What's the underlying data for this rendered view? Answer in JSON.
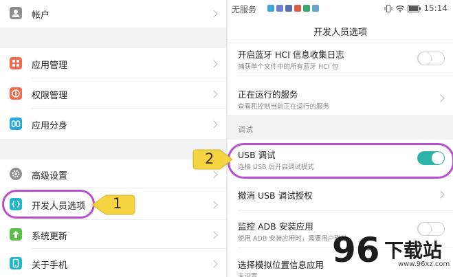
{
  "left": {
    "items": [
      {
        "label": "帐户",
        "icon": "account-icon",
        "color": "#8e8e8e"
      },
      {
        "label": "应用管理",
        "icon": "apps-icon",
        "color": "#f26b4f"
      },
      {
        "label": "权限管理",
        "icon": "permission-icon",
        "color": "#f26b4f"
      },
      {
        "label": "应用分身",
        "icon": "app-twin-icon",
        "color": "#23a9e0"
      },
      {
        "label": "高级设置",
        "icon": "gear-icon",
        "color": "#8e8e8e"
      },
      {
        "label": "开发人员选项",
        "icon": "developer-braces-icon",
        "color": "#23b5c8"
      },
      {
        "label": "系统更新",
        "icon": "update-arrow-icon",
        "color": "#5cbf4a"
      },
      {
        "label": "关于手机",
        "icon": "phone-icon",
        "color": "#23b5c8"
      }
    ]
  },
  "status": {
    "carrier": "无服务",
    "time": "15:14"
  },
  "right": {
    "title": "开发人员选项",
    "items": [
      {
        "title": "开启蓝牙 HCI 信息收集日志",
        "subtitle": "捕获单个文件中的所有蓝牙 HCI 包",
        "control": "toggle",
        "on": false
      },
      {
        "title": "正在运行的服务",
        "subtitle": "查看和控制当前正在运行的服务",
        "control": "chevron"
      },
      {
        "title": "USB 调试",
        "subtitle": "连接 USB 后开启调试模式",
        "control": "toggle",
        "on": true
      },
      {
        "title": "撤消 USB 调试授权",
        "subtitle": "",
        "control": "chevron"
      },
      {
        "title": "监控 ADB 安装应用",
        "subtitle": "使用 ADB 安装应用时，需要用户确认",
        "control": "toggle",
        "on": false
      },
      {
        "title": "选择模拟位置信息应用",
        "subtitle": "未设置",
        "control": "none"
      }
    ],
    "section_label": "调试"
  },
  "annotations": {
    "one": "1",
    "two": "2",
    "highlight_color": "#b84fd1",
    "callout_color": "#f5d442"
  },
  "watermark": {
    "number": "96",
    "text": "下载站",
    "url": "www.96xz.com"
  },
  "colors": {
    "accent": "#2cb4a9"
  }
}
